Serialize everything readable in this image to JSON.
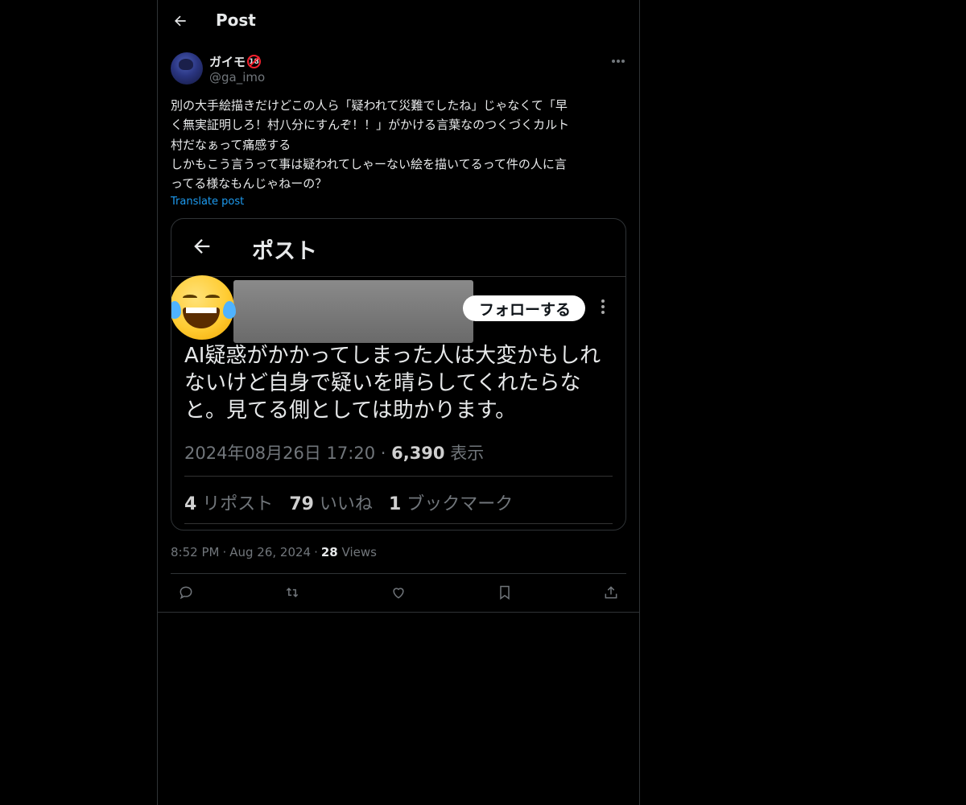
{
  "header": {
    "title": "Post"
  },
  "author": {
    "name": "ガイモ",
    "badge": "18",
    "handle": "@ga_imo"
  },
  "post": {
    "text": "別の大手絵描きだけどこの人ら「疑われて災難でしたね」じゃなくて「早\nく無実証明しろ！村八分にすんぞ！！」がかける言葉なのつくづくカルト\n村だなぁって痛感する\nしかもこう言うって事は疑われてしゃーない絵を描いてるって件の人に言\nってる様なもんじゃねーの？",
    "translate_label": "Translate post"
  },
  "media": {
    "header_title": "ポスト",
    "follow_label": "フォローする",
    "body": "AI疑惑がかかってしまった人は大変かもしれ\nないけど自身で疑いを晴らしてくれたらな\nと。見てる側としては助かります。",
    "date": "2024年08月26日 17:20 · ",
    "views_count": "6,390",
    "views_label": " 表示",
    "reposts_count": "4",
    "reposts_label": " リポスト",
    "likes_count": "79",
    "likes_label": " いいね",
    "bookmarks_count": "1",
    "bookmarks_label": " ブックマーク"
  },
  "meta": {
    "time": "8:52 PM",
    "sep1": "·",
    "date": "Aug 26, 2024",
    "sep2": "·",
    "views_count": "28",
    "views_label": "Views"
  },
  "colors": {
    "background": "#000000",
    "text": "#e7e9ea",
    "muted": "#71767b",
    "link": "#1d9bf0",
    "border": "#2f3336"
  },
  "icons": [
    "back-arrow-icon",
    "more-icon",
    "reply-icon",
    "repost-icon",
    "like-icon",
    "bookmark-icon",
    "share-icon"
  ]
}
